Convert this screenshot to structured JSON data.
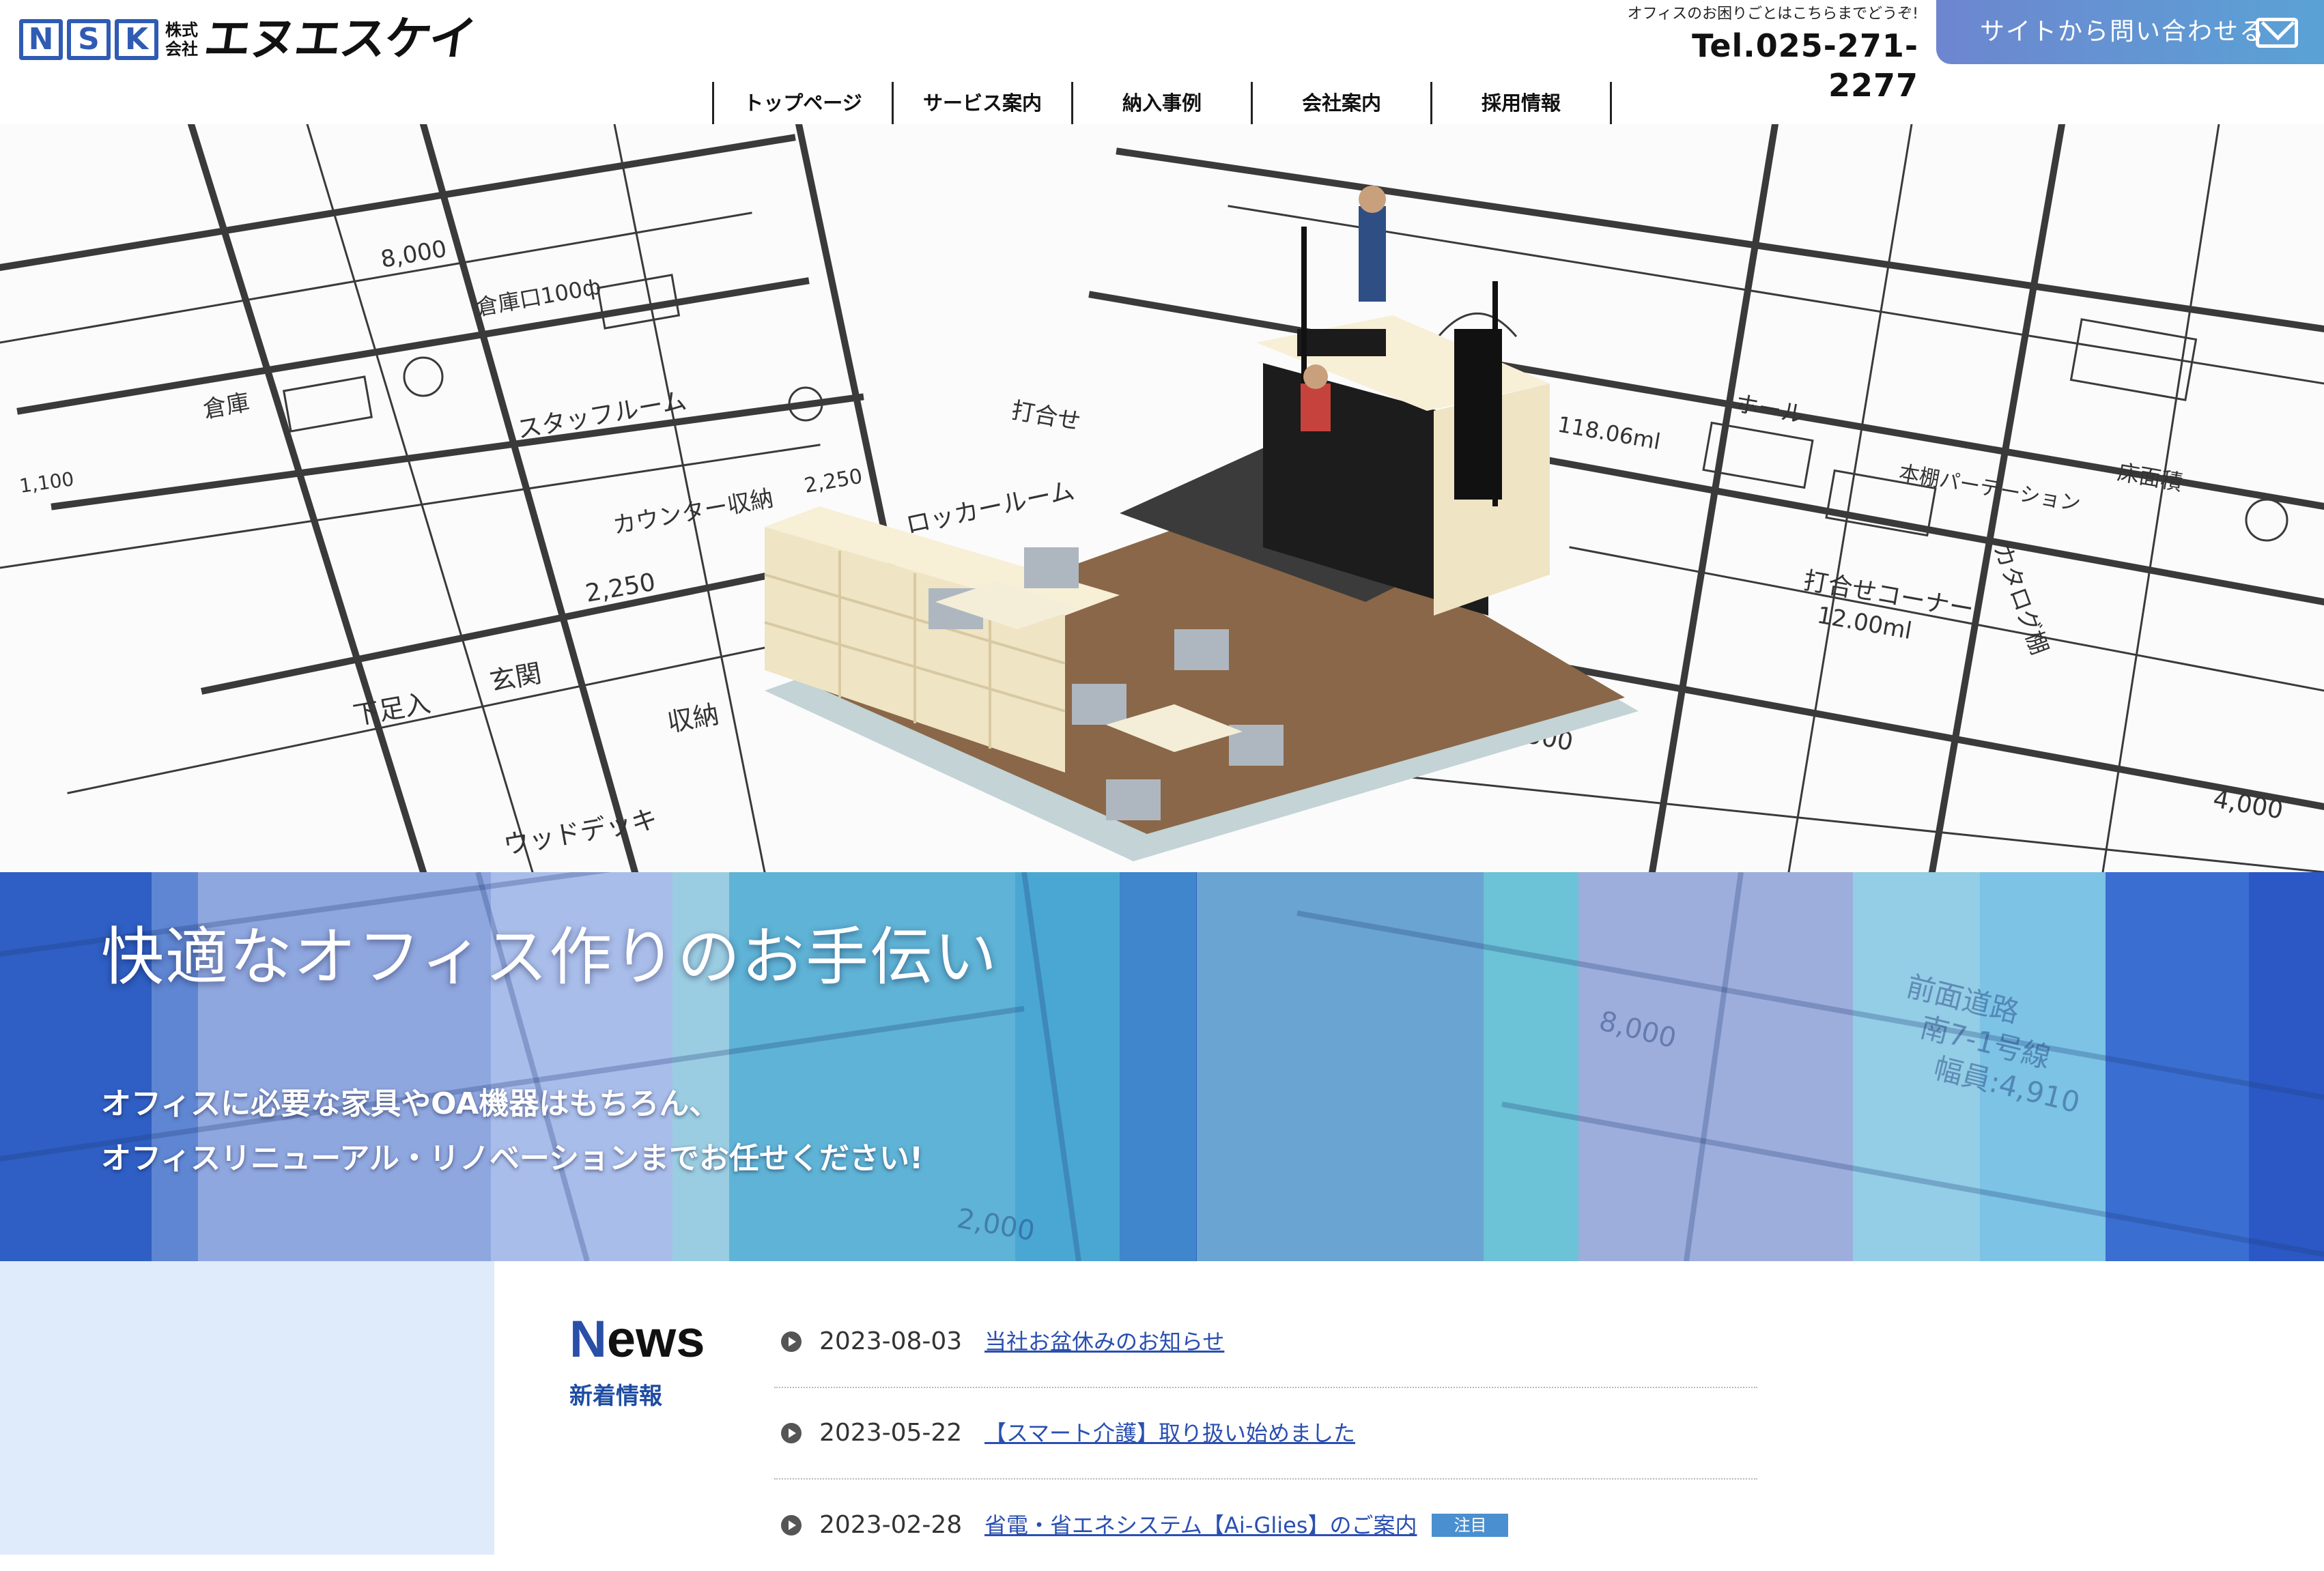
{
  "header": {
    "logo_letters": [
      "N",
      "S",
      "K"
    ],
    "logo_kk_top": "株式",
    "logo_kk_bottom": "会社",
    "logo_name": "エヌエスケイ",
    "tel_caption": "オフィスのお困りごとはこちらまでどうぞ!",
    "tel_number": "Tel.025-271-2277",
    "contact_label": "サイトから問い合わせる",
    "contact_icon": "mail-icon"
  },
  "nav": {
    "items": [
      "トップページ",
      "サービス案内",
      "納入事例",
      "会社案内",
      "採用情報"
    ]
  },
  "hero": {
    "title": "快適なオフィス作りのお手伝い",
    "sub_line1": "オフィスに必要な家具やOA機器はもちろん、",
    "sub_line2": "オフィスリニューアル・リノベーションまでお任せください!",
    "stripe_colors": [
      "#2f5fc4",
      "#5f86d2",
      "#8fa7df",
      "#a9bdea",
      "#9bcde2",
      "#5fb3d6",
      "#4aa7d3",
      "#3f86cc",
      "#3165c2",
      "#6aa4d2",
      "#5fa7cd",
      "#6cc2d6",
      "#9eaedc",
      "#94cde6",
      "#7cc3e6",
      "#3a6ed1",
      "#2b58c4"
    ],
    "blueprint_labels": [
      "8,000",
      "倉庫口100ф",
      "倉庫",
      "スタッフルーム",
      "打合せ",
      "カウンター収納",
      "2,250",
      "ロッカールーム",
      "2,250",
      "下足入",
      "玄関",
      "収納",
      "ウッドデッキ",
      "ホール",
      "118.06ml",
      "本棚パーテーション",
      "打合せコーナー",
      "12.00ml",
      "カタログ棚",
      "床面積",
      "前面道路",
      "南7-1号線",
      "幅員:4,910",
      "4,000",
      "8,000",
      "2,000",
      "3,500",
      "1,100"
    ]
  },
  "news": {
    "title_first": "N",
    "title_rest": "ews",
    "subtitle": "新着情報",
    "items": [
      {
        "date": "2023-08-03",
        "text": "当社お盆休みのお知らせ",
        "badge": ""
      },
      {
        "date": "2023-05-22",
        "text": "【スマート介護】取り扱い始めました",
        "badge": ""
      },
      {
        "date": "2023-02-28",
        "text": "省電・省エネシステム【Ai-Glies】のご案内",
        "badge": "注目"
      }
    ]
  }
}
